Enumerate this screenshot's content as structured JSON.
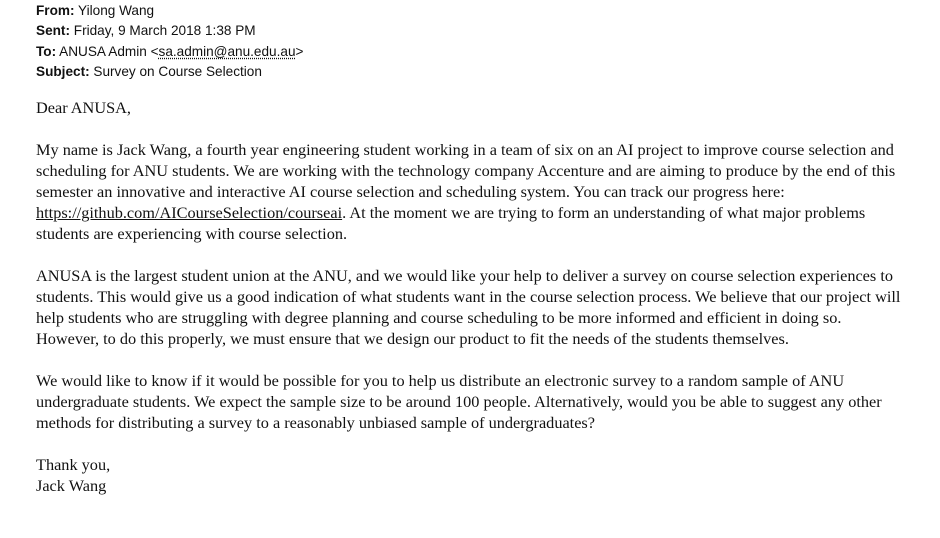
{
  "header": {
    "from_label": "From:",
    "from_value": "Yilong Wang",
    "sent_label": "Sent:",
    "sent_value": "Friday, 9 March 2018 1:38 PM",
    "to_label": "To:",
    "to_name": "ANUSA Admin <",
    "to_email": "sa.admin@anu.edu.au",
    "to_close": ">",
    "subject_label": "Subject:",
    "subject_value": "Survey on Course Selection"
  },
  "body": {
    "greeting": "Dear ANUSA,",
    "p1_before_link": "My name is Jack Wang, a fourth year engineering student working in a team of six on an AI project to improve course selection and scheduling for ANU students. We are working with the technology company Accenture and are aiming to produce by the end of this semester an innovative and interactive AI course selection and scheduling system. You can track our progress here: ",
    "p1_link": "https://github.com/AICourseSelection/courseai",
    "p1_after_link": ". At the moment we are trying to form an understanding of what major problems students are experiencing with course selection.",
    "p2": "ANUSA is the largest student union at the ANU, and we would like your help to deliver a survey on course selection experiences to students. This would give us a good indication of what students want in the course selection process. We believe that our project will help students who are struggling with degree planning and course scheduling to be more informed and efficient in doing so. However, to do this properly, we must ensure that we design our product to fit the needs of the students themselves.",
    "p3": "We would like to know if it would be possible for you to help us distribute an electronic survey to a random sample of ANU undergraduate students. We expect the sample size to be around 100 people. Alternatively, would you be able to suggest any other methods for distributing a survey to a reasonably unbiased sample of undergraduates?",
    "signoff": "Thank you,",
    "signature": "Jack Wang"
  }
}
